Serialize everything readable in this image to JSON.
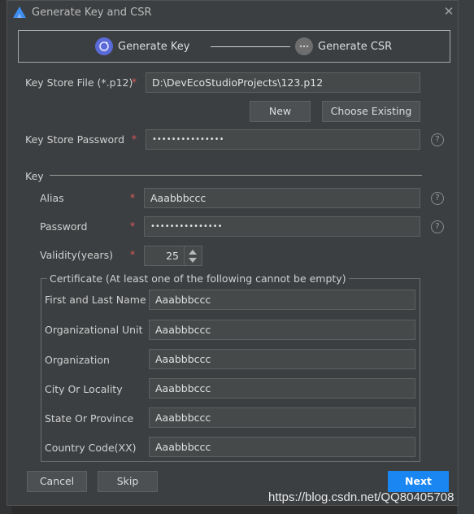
{
  "title": "Generate Key and CSR",
  "steps": [
    {
      "label": "Generate Key",
      "active": true
    },
    {
      "label": "Generate CSR",
      "active": false
    }
  ],
  "keystore": {
    "file_label": "Key Store File (*.p12)",
    "file_value": "D:\\DevEcoStudioProjects\\123.p12",
    "new_label": "New",
    "choose_label": "Choose Existing",
    "password_label": "Key Store Password",
    "password_value": "•••••••••••••••"
  },
  "key": {
    "section_label": "Key",
    "alias_label": "Alias",
    "alias_value": "Aaabbbccc",
    "password_label": "Password",
    "password_value": "•••••••••••••••",
    "validity_label": "Validity(years)",
    "validity_value": "25"
  },
  "certificate": {
    "legend": "Certificate (At least one of the following cannot be empty)",
    "fields": [
      {
        "label": "First and Last Name",
        "value": "Aaabbbccc"
      },
      {
        "label": "Organizational Unit",
        "value": "Aaabbbccc"
      },
      {
        "label": "Organization",
        "value": "Aaabbbccc"
      },
      {
        "label": "City Or Locality",
        "value": "Aaabbbccc"
      },
      {
        "label": "State Or Province",
        "value": "Aaabbbccc"
      },
      {
        "label": "Country Code(XX)",
        "value": "Aaabbbccc"
      }
    ]
  },
  "required_mark": "*",
  "help_glyph": "?",
  "close_glyph": "✕",
  "step1_glyph": "↻",
  "step2_glyph": "···",
  "footer": {
    "cancel_label": "Cancel",
    "skip_label": "Skip",
    "next_label": "Next"
  },
  "watermark": "https://blog.csdn.net/QQ80405708",
  "colors": {
    "accent": "#1a86f2",
    "step_active": "#5a6bd8",
    "required": "#e05a5a"
  }
}
